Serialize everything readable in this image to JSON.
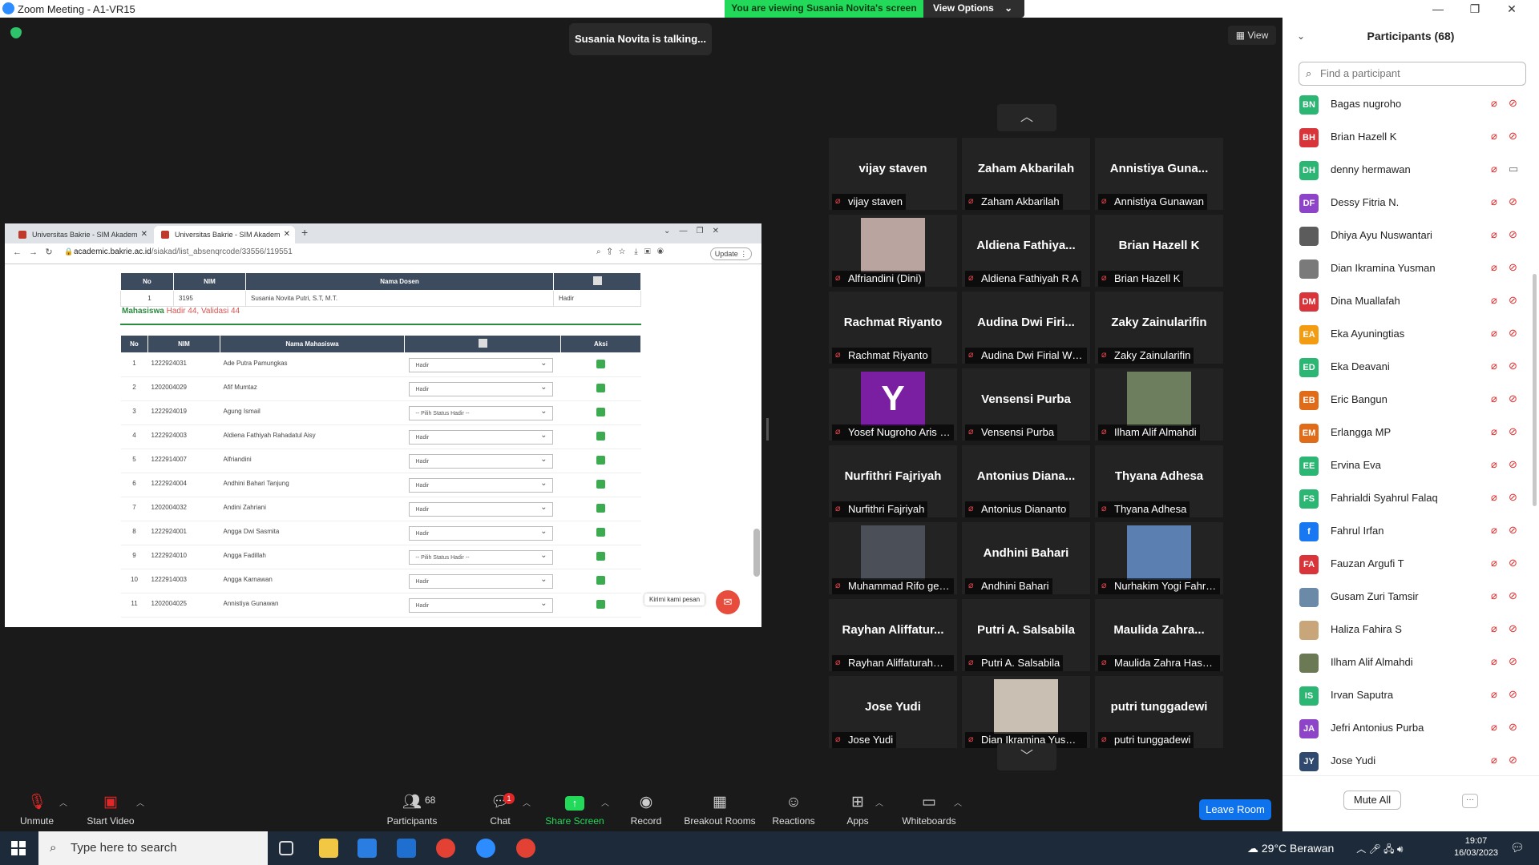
{
  "window": {
    "title": "Zoom Meeting - A1-VR15"
  },
  "banner": {
    "message": "You are viewing Susania Novita's screen",
    "options_label": "View Options"
  },
  "talking": "Susania Novita is talking...",
  "view_button": "View",
  "shared_screen": {
    "tabs": [
      {
        "label": "Universitas Bakrie - SIM Akadem"
      },
      {
        "label": "Universitas Bakrie - SIM Akadem"
      }
    ],
    "url_host": "academic.bakrie.ac.id",
    "url_path": "/siakad/list_absenqrcode/33556/119551",
    "update_label": "Update",
    "dosen_table": {
      "headers": [
        "No",
        "NIM",
        "Nama Dosen",
        ""
      ],
      "row": {
        "no": "1",
        "nim": "3195",
        "name": "Susania Novita Putri, S.T, M.T.",
        "status": "Hadir"
      }
    },
    "summary": {
      "label": "Mahasiswa",
      "hadir": "Hadir 44",
      "sep": ",",
      "validasi": "Validasi 44"
    },
    "student_headers": [
      "No",
      "NIM",
      "Nama Mahasiswa",
      "",
      "Aksi"
    ],
    "students": [
      {
        "no": "1",
        "nim": "1222924031",
        "name": "Ade Putra Pamungkas",
        "status": "Hadir"
      },
      {
        "no": "2",
        "nim": "1202004029",
        "name": "Afif Mumtaz",
        "status": "Hadir"
      },
      {
        "no": "3",
        "nim": "1222924019",
        "name": "Agung Ismail",
        "status": "-- Pilih Status Hadir --"
      },
      {
        "no": "4",
        "nim": "1222924003",
        "name": "Aldiena Fathiyah Rahadatul Aisy",
        "status": "Hadir"
      },
      {
        "no": "5",
        "nim": "1222914007",
        "name": "Alfriandini",
        "status": "Hadir"
      },
      {
        "no": "6",
        "nim": "1222924004",
        "name": "Andhini Bahari Tanjung",
        "status": "Hadir"
      },
      {
        "no": "7",
        "nim": "1202004032",
        "name": "Andini Zahriani",
        "status": "Hadir"
      },
      {
        "no": "8",
        "nim": "1222924001",
        "name": "Angga Dwi Sasmita",
        "status": "Hadir"
      },
      {
        "no": "9",
        "nim": "1222924010",
        "name": "Angga Fadillah",
        "status": "-- Pilih Status Hadir --"
      },
      {
        "no": "10",
        "nim": "1222914003",
        "name": "Angga Karnawan",
        "status": "Hadir"
      },
      {
        "no": "11",
        "nim": "1202004025",
        "name": "Annistiya Gunawan",
        "status": "Hadir"
      }
    ],
    "chat_widget": "Kirimi kami pesan"
  },
  "gallery": [
    {
      "big": "vijay staven",
      "name": "vijay staven"
    },
    {
      "big": "Zaham Akbarilah",
      "name": "Zaham Akbarilah"
    },
    {
      "big": "Annistiya Guna...",
      "name": "Annistiya Gunawan"
    },
    {
      "big": "",
      "name": "Alfriandini (Dini)"
    },
    {
      "big": "Aldiena Fathiya...",
      "name": "Aldiena Fathiyah R A"
    },
    {
      "big": "Brian Hazell K",
      "name": "Brian Hazell K"
    },
    {
      "big": "Rachmat Riyanto",
      "name": "Rachmat Riyanto"
    },
    {
      "big": "Audina Dwi Firi...",
      "name": "Audina Dwi Firial Wid..."
    },
    {
      "big": "Zaky Zainularifin",
      "name": "Zaky Zainularifin"
    },
    {
      "big": "Y",
      "name": "Yosef Nugroho Aris P..."
    },
    {
      "big": "Vensensi Purba",
      "name": "Vensensi Purba"
    },
    {
      "big": "",
      "name": "Ilham Alif Almahdi"
    },
    {
      "big": "Nurfithri Fajriyah",
      "name": "Nurfithri Fajriyah"
    },
    {
      "big": "Antonius Diana...",
      "name": "Antonius Diananto"
    },
    {
      "big": "Thyana Adhesa",
      "name": "Thyana Adhesa"
    },
    {
      "big": "",
      "name": "Muhammad Rifo ges..."
    },
    {
      "big": "Andhini Bahari",
      "name": "Andhini Bahari"
    },
    {
      "big": "",
      "name": "Nurhakim Yogi Fahrezy"
    },
    {
      "big": "Rayhan Aliffatur...",
      "name": "Rayhan Aliffaturahman"
    },
    {
      "big": "Putri A. Salsabila",
      "name": "Putri A. Salsabila"
    },
    {
      "big": "Maulida Zahra...",
      "name": "Maulida Zahra Hasana"
    },
    {
      "big": "Jose Yudi",
      "name": "Jose Yudi"
    },
    {
      "big": "",
      "name": "Dian Ikramina Yusman"
    },
    {
      "big": "putri tunggadewi",
      "name": "putri tunggadewi"
    }
  ],
  "participants_panel": {
    "title": "Participants (68)",
    "search_placeholder": "Find a participant",
    "list": [
      {
        "initials": "BN",
        "name": "Bagas nugroho",
        "color": "#2bb673"
      },
      {
        "initials": "BH",
        "name": "Brian Hazell K",
        "color": "#d9343a"
      },
      {
        "initials": "DH",
        "name": "denny hermawan",
        "color": "#2bb673"
      },
      {
        "initials": "DF",
        "name": "Dessy Fitria N.",
        "color": "#8e44c9"
      },
      {
        "initials": "",
        "name": "Dhiya Ayu Nuswantari",
        "color": "#5c5c5c"
      },
      {
        "initials": "",
        "name": "Dian Ikramina Yusman",
        "color": "#7a7a7a"
      },
      {
        "initials": "DM",
        "name": "Dina Muallafah",
        "color": "#d9343a"
      },
      {
        "initials": "EA",
        "name": "Eka Ayuningtias",
        "color": "#f39c12"
      },
      {
        "initials": "ED",
        "name": "Eka Deavani",
        "color": "#2bb673"
      },
      {
        "initials": "EB",
        "name": "Eric Bangun",
        "color": "#e06c1a"
      },
      {
        "initials": "EM",
        "name": "Erlangga MP",
        "color": "#e06c1a"
      },
      {
        "initials": "EE",
        "name": "Ervina Eva",
        "color": "#2bb673"
      },
      {
        "initials": "FS",
        "name": "Fahrialdi Syahrul Falaq",
        "color": "#2bb673"
      },
      {
        "initials": "f",
        "name": "Fahrul Irfan",
        "color": "#1877f2"
      },
      {
        "initials": "FA",
        "name": "Fauzan Argufi T",
        "color": "#d9343a"
      },
      {
        "initials": "",
        "name": "Gusam Zuri Tamsir",
        "color": "#6a8aa8"
      },
      {
        "initials": "",
        "name": "Haliza Fahira S",
        "color": "#c9a57a"
      },
      {
        "initials": "",
        "name": "Ilham Alif Almahdi",
        "color": "#6b7a55"
      },
      {
        "initials": "IS",
        "name": "Irvan Saputra",
        "color": "#2bb673"
      },
      {
        "initials": "JA",
        "name": "Jefri Antonius Purba",
        "color": "#8e44c9"
      },
      {
        "initials": "JY",
        "name": "Jose Yudi",
        "color": "#2f4a6e"
      }
    ],
    "mute_all": "Mute All",
    "more": "···"
  },
  "toolbar": {
    "unmute": "Unmute",
    "start_video": "Start Video",
    "participants": "Participants",
    "participant_count": "68",
    "chat": "Chat",
    "chat_badge": "1",
    "share_screen": "Share Screen",
    "record": "Record",
    "breakout": "Breakout Rooms",
    "reactions": "Reactions",
    "apps": "Apps",
    "whiteboards": "Whiteboards",
    "leave": "Leave Room"
  },
  "taskbar": {
    "search_placeholder": "Type here to search",
    "weather": "29°C Berawan",
    "time": "19:07",
    "date": "16/03/2023"
  },
  "colors": {
    "zoom_blue": "#0e72ed",
    "banner_green": "#23d959",
    "muted_red": "#e02828"
  }
}
